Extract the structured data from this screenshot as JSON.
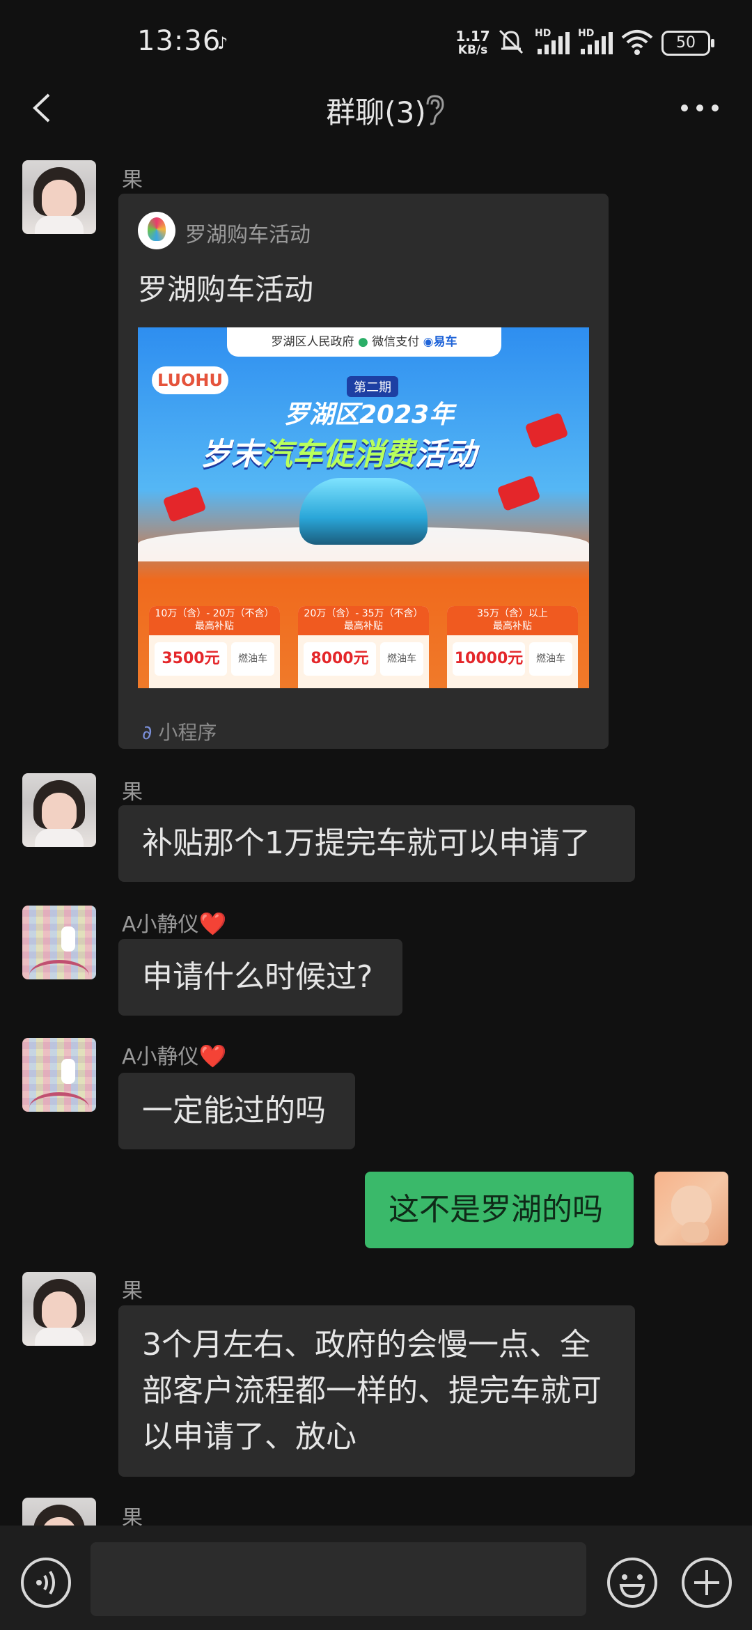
{
  "status_bar": {
    "time": "13:36",
    "net_rate_top": "1.17",
    "net_rate_unit": "KB/s",
    "hd1": "HD",
    "hd2": "HD",
    "battery": "50"
  },
  "header": {
    "title": "群聊(3)"
  },
  "messages": [
    {
      "sender": "果",
      "type": "mini-program",
      "mp_name": "罗湖购车活动",
      "mp_title": "罗湖购车活动",
      "poster": {
        "top_banner_gov": "罗湖区人民政府",
        "top_banner_wx": "微信支付",
        "top_banner_yiche": "易车",
        "logo_text": "LUOHU",
        "issue": "第二期",
        "headline_1": "罗湖区2023年",
        "headline_2a": "岁末",
        "headline_2b": "汽车促消费",
        "headline_2c": "活动",
        "tiers": [
          {
            "range": "10万（含）- 20万（不含）",
            "caption": "最高补贴",
            "amount": "3500元",
            "type": "燃油车"
          },
          {
            "range": "20万（含）- 35万（不含）",
            "caption": "最高补贴",
            "amount": "8000元",
            "type": "燃油车"
          },
          {
            "range": "35万（含）以上",
            "caption": "最高补贴",
            "amount": "10000元",
            "type": "燃油车"
          }
        ]
      },
      "tag": "小程序"
    },
    {
      "sender": "果",
      "text": "补贴那个1万提完车就可以申请了"
    },
    {
      "sender": "A小静仪",
      "sender_emoji": "❤️",
      "text": "申请什么时候过?"
    },
    {
      "sender": "A小静仪",
      "sender_emoji": "❤️",
      "text": "一定能过的吗"
    },
    {
      "sender": "me",
      "text": "这不是罗湖的吗"
    },
    {
      "sender": "果",
      "lines": [
        "3个月左右、政府的会慢一点、全",
        "部客户流程都一样的、提完车就可",
        "以申请了、放心"
      ]
    },
    {
      "sender": "果"
    }
  ],
  "icons": {
    "back": "chevron-left-icon",
    "ear": "ear-icon",
    "more": "more-icon",
    "voice": "voice-icon",
    "emoji": "emoji-icon",
    "plus": "plus-icon"
  },
  "colors": {
    "background": "#111111",
    "bubble_other": "#2c2c2c",
    "bubble_me": "#3ab96a"
  }
}
